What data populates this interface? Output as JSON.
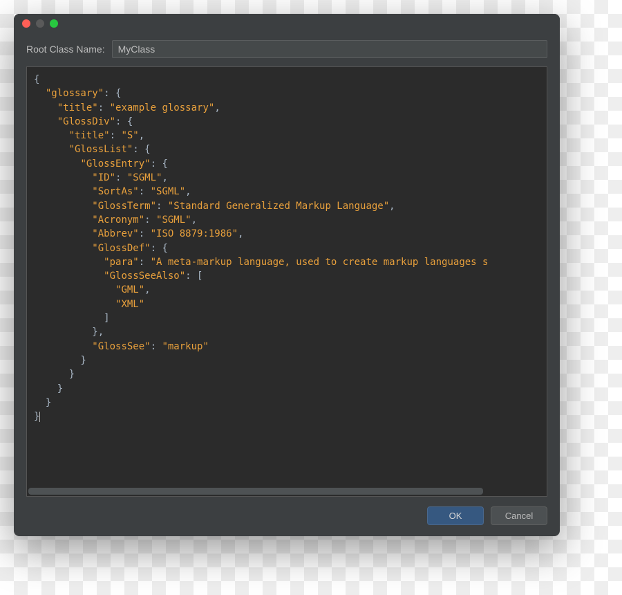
{
  "field": {
    "label": "Root Class Name:",
    "value": "MyClass"
  },
  "code": {
    "tokens": [
      {
        "t": "p",
        "v": "{\n  "
      },
      {
        "t": "k",
        "v": "\"glossary\""
      },
      {
        "t": "p",
        "v": ": {\n    "
      },
      {
        "t": "k",
        "v": "\"title\""
      },
      {
        "t": "p",
        "v": ": "
      },
      {
        "t": "s",
        "v": "\"example glossary\""
      },
      {
        "t": "p",
        "v": ",\n    "
      },
      {
        "t": "k",
        "v": "\"GlossDiv\""
      },
      {
        "t": "p",
        "v": ": {\n      "
      },
      {
        "t": "k",
        "v": "\"title\""
      },
      {
        "t": "p",
        "v": ": "
      },
      {
        "t": "s",
        "v": "\"S\""
      },
      {
        "t": "p",
        "v": ",\n      "
      },
      {
        "t": "k",
        "v": "\"GlossList\""
      },
      {
        "t": "p",
        "v": ": {\n        "
      },
      {
        "t": "k",
        "v": "\"GlossEntry\""
      },
      {
        "t": "p",
        "v": ": {\n          "
      },
      {
        "t": "k",
        "v": "\"ID\""
      },
      {
        "t": "p",
        "v": ": "
      },
      {
        "t": "s",
        "v": "\"SGML\""
      },
      {
        "t": "p",
        "v": ",\n          "
      },
      {
        "t": "k",
        "v": "\"SortAs\""
      },
      {
        "t": "p",
        "v": ": "
      },
      {
        "t": "s",
        "v": "\"SGML\""
      },
      {
        "t": "p",
        "v": ",\n          "
      },
      {
        "t": "k",
        "v": "\"GlossTerm\""
      },
      {
        "t": "p",
        "v": ": "
      },
      {
        "t": "s",
        "v": "\"Standard Generalized Markup Language\""
      },
      {
        "t": "p",
        "v": ",\n          "
      },
      {
        "t": "k",
        "v": "\"Acronym\""
      },
      {
        "t": "p",
        "v": ": "
      },
      {
        "t": "s",
        "v": "\"SGML\""
      },
      {
        "t": "p",
        "v": ",\n          "
      },
      {
        "t": "k",
        "v": "\"Abbrev\""
      },
      {
        "t": "p",
        "v": ": "
      },
      {
        "t": "s",
        "v": "\"ISO 8879:1986\""
      },
      {
        "t": "p",
        "v": ",\n          "
      },
      {
        "t": "k",
        "v": "\"GlossDef\""
      },
      {
        "t": "p",
        "v": ": {\n            "
      },
      {
        "t": "k",
        "v": "\"para\""
      },
      {
        "t": "p",
        "v": ": "
      },
      {
        "t": "s",
        "v": "\"A meta-markup language, used to create markup languages s"
      },
      {
        "t": "p",
        "v": "\n            "
      },
      {
        "t": "k",
        "v": "\"GlossSeeAlso\""
      },
      {
        "t": "p",
        "v": ": [\n              "
      },
      {
        "t": "s",
        "v": "\"GML\""
      },
      {
        "t": "p",
        "v": ",\n              "
      },
      {
        "t": "s",
        "v": "\"XML\""
      },
      {
        "t": "p",
        "v": "\n            ]\n          },\n          "
      },
      {
        "t": "k",
        "v": "\"GlossSee\""
      },
      {
        "t": "p",
        "v": ": "
      },
      {
        "t": "s",
        "v": "\"markup\""
      },
      {
        "t": "p",
        "v": "\n        }\n      }\n    }\n  }\n}"
      }
    ]
  },
  "buttons": {
    "ok": "OK",
    "cancel": "Cancel"
  }
}
